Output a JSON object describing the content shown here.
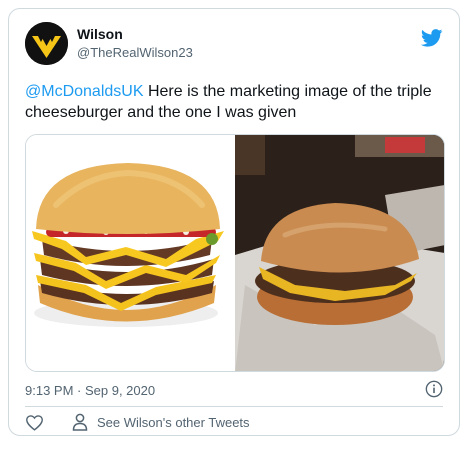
{
  "tweet": {
    "author_name": "Wilson",
    "author_handle": "@TheRealWilson23",
    "mention": "@McDonaldsUK",
    "text": " Here is the marketing image of the triple cheeseburger and the one I was given",
    "timestamp": "9:13 PM · Sep 9, 2020",
    "other_tweets_label": "See Wilson's other Tweets"
  },
  "colors": {
    "accent": "#1d9bf0",
    "text_primary": "#0f1419",
    "text_secondary": "#536471",
    "avatar_logo": "#f5c518"
  },
  "icons": {
    "brand": "twitter-bird-icon",
    "info": "info-icon",
    "like": "heart-icon",
    "profile": "user-icon"
  }
}
